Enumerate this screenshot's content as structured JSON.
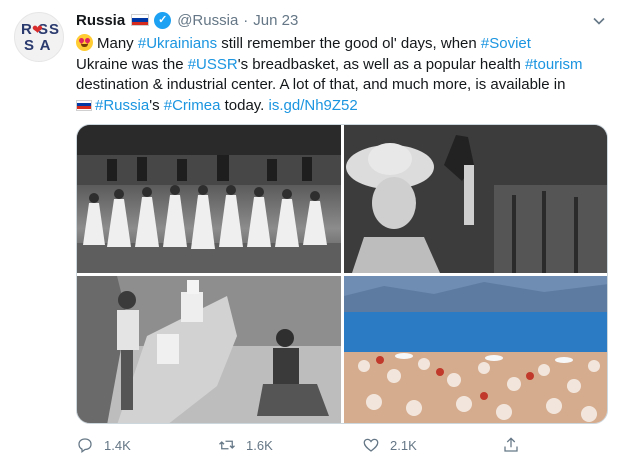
{
  "tweet": {
    "account_name": "Russia",
    "handle": "@Russia",
    "separator": "·",
    "date": "Jun 23",
    "avatar_text": {
      "top": "R SS",
      "bottom": "S A"
    },
    "text_lines": [
      [
        {
          "t": "emoji",
          "name": "heart-eyes-emoji"
        },
        {
          "t": "text",
          "v": "Many "
        },
        {
          "t": "tag",
          "v": "#Ukrainians"
        },
        {
          "t": "text",
          "v": " still remember the good ol' days, when "
        },
        {
          "t": "tag",
          "v": "#Soviet"
        }
      ],
      [
        {
          "t": "text",
          "v": "Ukraine was the "
        },
        {
          "t": "tag",
          "v": "#USSR"
        },
        {
          "t": "text",
          "v": "'s breadbasket, as well as a popular health "
        },
        {
          "t": "tag",
          "v": "#tourism"
        }
      ],
      [
        {
          "t": "text",
          "v": "destination & industrial center. A lot of that, and much more, is available in"
        }
      ],
      [
        {
          "t": "flag",
          "name": "russia-flag-emoji"
        },
        {
          "t": "tag",
          "v": "#Russia"
        },
        {
          "t": "text",
          "v": "'s "
        },
        {
          "t": "tag",
          "v": "#Crimea"
        },
        {
          "t": "text",
          "v": " today. "
        },
        {
          "t": "tag",
          "v": "is.gd/Nh9Z52"
        }
      ]
    ],
    "photos": [
      {
        "name": "photo-folk-dancers"
      },
      {
        "name": "photo-woman-grapes"
      },
      {
        "name": "photo-painter-cliff"
      },
      {
        "name": "photo-crowded-beach"
      }
    ],
    "actions": {
      "reply_count": "1.4K",
      "retweet_count": "1.6K",
      "like_count": "2.1K"
    }
  },
  "colors": {
    "link": "#1b95e0",
    "muted": "#657786",
    "verified": "#1da1f2",
    "flag": [
      "#ffffff",
      "#0039a6",
      "#d52b1e"
    ]
  }
}
